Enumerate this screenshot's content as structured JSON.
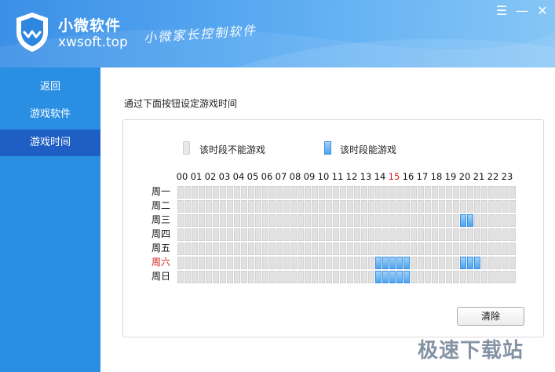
{
  "header": {
    "brand_name": "小微软件",
    "brand_domain": "xwsoft.top",
    "slogan": "小微家长控制软件"
  },
  "window_controls": {
    "menu": "☰",
    "minimize": "—",
    "close": "✕"
  },
  "sidebar": {
    "items": [
      {
        "label": "返回",
        "active": false
      },
      {
        "label": "游戏软件",
        "active": false
      },
      {
        "label": "游戏时间",
        "active": true
      }
    ]
  },
  "main": {
    "instruction": "通过下面按钮设定游戏时间",
    "legend": {
      "off_label": "该时段不能游戏",
      "on_label": "该时段能游戏"
    },
    "hours": [
      "00",
      "01",
      "02",
      "03",
      "04",
      "05",
      "06",
      "07",
      "08",
      "09",
      "10",
      "11",
      "12",
      "13",
      "14",
      "15",
      "16",
      "17",
      "18",
      "19",
      "20",
      "21",
      "22",
      "23"
    ],
    "current_hour": "15",
    "days": [
      "周一",
      "周二",
      "周三",
      "周四",
      "周五",
      "周六",
      "周日"
    ],
    "current_day": "周六",
    "schedule": {
      "周一": [],
      "周二": [],
      "周三": [
        [
          "20",
          0
        ],
        [
          "20",
          1
        ]
      ],
      "周四": [],
      "周五": [],
      "周六": [
        [
          "14",
          0
        ],
        [
          "14",
          1
        ],
        [
          "15",
          0
        ],
        [
          "15",
          1
        ],
        [
          "16",
          0
        ],
        [
          "20",
          0
        ],
        [
          "20",
          1
        ],
        [
          "21",
          0
        ]
      ],
      "周日": [
        [
          "14",
          0
        ],
        [
          "14",
          1
        ],
        [
          "15",
          0
        ],
        [
          "15",
          1
        ],
        [
          "16",
          0
        ]
      ]
    },
    "clear_button": "清除"
  },
  "colors": {
    "header_start": "#3b8fe6",
    "sidebar_bg": "#2a8fe3",
    "sidebar_active": "#1f5fc4",
    "cell_off": "#e1e1e1",
    "cell_on": "#4fa4ec",
    "today_red": "#d32020"
  },
  "watermark": "极速下载站"
}
